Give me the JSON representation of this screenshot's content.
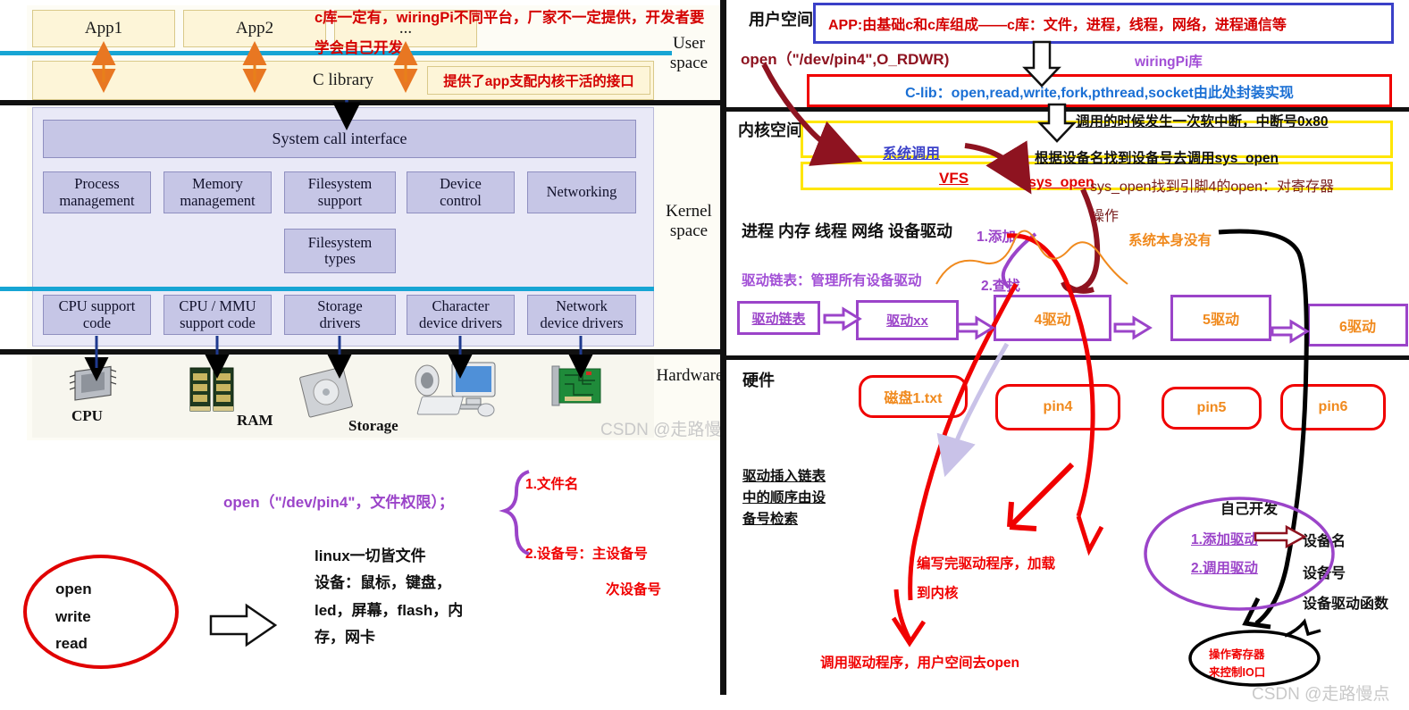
{
  "left_diagram": {
    "apps": [
      "App1",
      "App2"
    ],
    "ellipsis": "...",
    "c_library": "C library",
    "system_call_interface": "System call interface",
    "kernel_boxes_row1": [
      "Process\nmanagement",
      "Memory\nmanagement",
      "Filesystem\nsupport",
      "Device\ncontrol",
      "Networking"
    ],
    "kernel_box_fs_types": "Filesystem\ntypes",
    "kernel_boxes_row2": [
      "CPU support\ncode",
      "CPU / MMU\nsupport code",
      "Storage\ndrivers",
      "Character\ndevice drivers",
      "Network\ndevice drivers"
    ],
    "side_labels": {
      "user_space": "User\nspace",
      "kernel_space": "Kernel\nspace",
      "hardware": "Hardware"
    },
    "hardware_labels": [
      "CPU",
      "RAM",
      "Storage"
    ],
    "annotations": {
      "top_red_line1": "c库一定有，wiringPi不同平台，厂家不一定提供，开发者要",
      "top_red_line2": "学会自己开发",
      "clib_note": "提供了app支配内核干活的接口"
    },
    "watermark": "CSDN @走路慢点"
  },
  "left_bottom": {
    "open_call": "open（\"/dev/pin4\"，文件权限）；",
    "brace_note_1": "1.文件名",
    "brace_note_2": "2.设备号：主设备号",
    "brace_note_3": "次设备号",
    "circle_items": [
      "open",
      "write",
      "read"
    ],
    "file_notes": [
      "linux一切皆文件",
      "设备：鼠标，键盘，",
      "led，屏幕，flash，内",
      "存，网卡"
    ]
  },
  "right_panel": {
    "user_space_label": "用户空间",
    "kernel_space_label": "内核空间",
    "hardware_label": "硬件",
    "app_box": "APP:由基础c和c库组成——c库：文件，进程，线程，网络，进程通信等",
    "open_line": "open（\"/dev/pin4\",O_RDWR)",
    "wiringpi_lib": "wiringPi库",
    "clib_box": "C-lib：open,read,write,fork,pthread,socket由此处封装实现",
    "softirq_note": "调用的时候发生一次软中断，中断号0x80",
    "syscall_label": "系统调用",
    "vfs_label": "VFS",
    "sys_open_label": "sys_open",
    "devname_note": "根据设备名找到设备号去调用sys_open",
    "sysopen_note_line1": "sys_open找到引脚4的open：对寄存器",
    "sysopen_note_line2": "操作",
    "kernel_modules": "进程 内存 线程 网络 设备驱动",
    "drv_list_note": "驱动链表：管理所有设备驱动",
    "step_add": "1.添加",
    "step_find": "2.查找",
    "no_system": "系统本身没有",
    "driver_chain": [
      "驱动链表",
      "驱动xx",
      "4驱动",
      "5驱动",
      "6驱动"
    ],
    "hw_items": [
      "磁盘1.txt",
      "pin4",
      "pin5",
      "pin6"
    ],
    "insert_note": [
      "驱动插入链表",
      "中的顺序由设",
      "备号检索"
    ],
    "write_driver_note_l1": "编写完驱动程序，加载",
    "write_driver_note_l2": "到内核",
    "call_driver_note": "调用驱动程序，用户空间去open",
    "self_dev_title": "自己开发",
    "self_dev_1": "1.添加驱动",
    "self_dev_2": "2.调用驱动",
    "dev_name": "设备名",
    "dev_num": "设备号",
    "dev_func": "设备驱动函数",
    "reg_note_1": "操作寄存器",
    "reg_note_2": "来控制IO口",
    "watermark": "CSDN @走路慢点"
  },
  "colors": {
    "red": "#f00000",
    "blue": "#3a40c8",
    "yellow": "#ffe600",
    "purple": "#9b44c9",
    "orange": "#f08a1e",
    "darkred": "#8e1320",
    "cyan": "#17a5d4"
  }
}
